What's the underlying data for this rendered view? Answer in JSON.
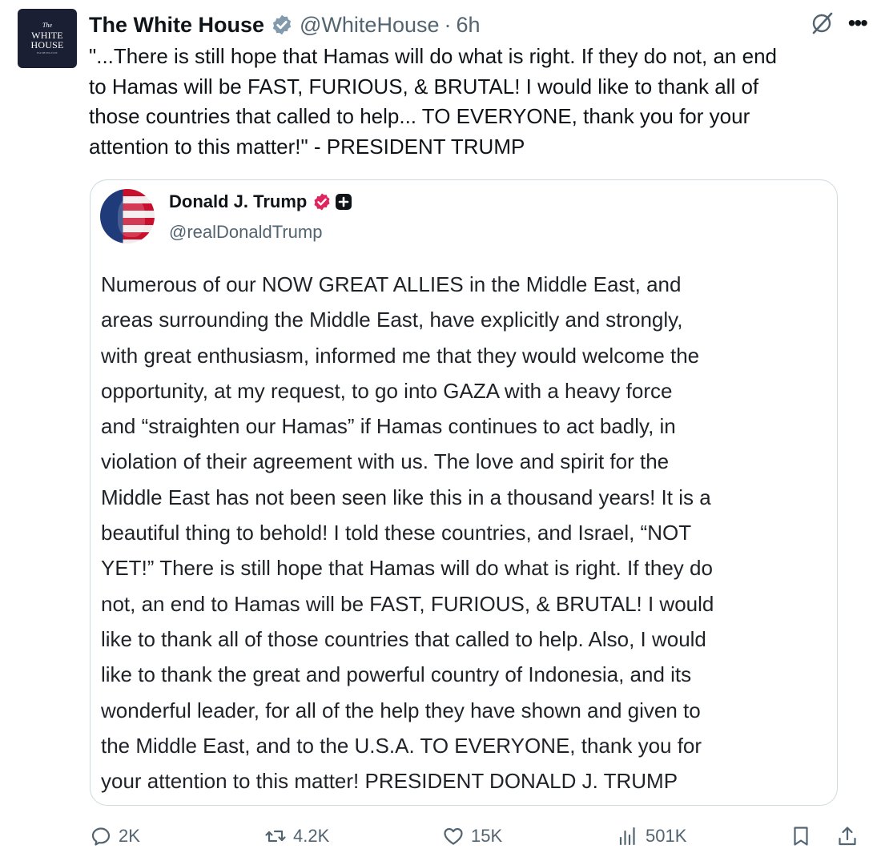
{
  "tweet": {
    "author_name": "The White House",
    "handle": "@WhiteHouse",
    "separator": "·",
    "time": "6h",
    "avatar": {
      "line_the": "The",
      "line1": "WHITE",
      "line2": "HOUSE",
      "sub": "WASHINGTON"
    },
    "verified_icon": "gray-verified-badge-icon",
    "text": "\"...There is still hope that Hamas will do what is right. If they do not, an end\nto Hamas will be FAST, FURIOUS, & BRUTAL! I would like to thank all of\nthose countries that called to help... TO EVERYONE, thank you for your\nattention to this matter!\" - PRESIDENT TRUMP"
  },
  "quoted": {
    "author_name": "Donald J. Trump",
    "handle": "@realDonaldTrump",
    "text": "Numerous of our NOW GREAT ALLIES in the Middle East, and\nareas surrounding the Middle East, have explicitly and strongly,\nwith great enthusiasm, informed me that they would welcome the\nopportunity, at my request, to go into GAZA with a heavy force\nand “straighten our Hamas” if Hamas continues to act badly, in\nviolation of their agreement with us. The love and spirit for the\nMiddle East has not been seen like this in a thousand years! It is a\nbeautiful thing to behold! I told these countries, and Israel, “NOT\nYET!” There is still hope that Hamas will do what is right. If they do\nnot, an end to Hamas will be FAST, FURIOUS, & BRUTAL! I would\nlike to thank all of those countries that called to help. Also, I would\nlike to thank the great and powerful country of Indonesia, and its\nwonderful leader, for all of the help they have shown and given to\nthe Middle East, and to the U.S.A. TO EVERYONE, thank you for\nyour attention to this matter! PRESIDENT DONALD J. TRUMP"
  },
  "actions": {
    "replies": "2K",
    "reposts": "4.2K",
    "likes": "15K",
    "views": "501K"
  },
  "colors": {
    "text": "#0f1419",
    "muted": "#536471",
    "border": "#cfd9de",
    "gov_badge": "#829aab",
    "red_badge": "#e0245e"
  }
}
